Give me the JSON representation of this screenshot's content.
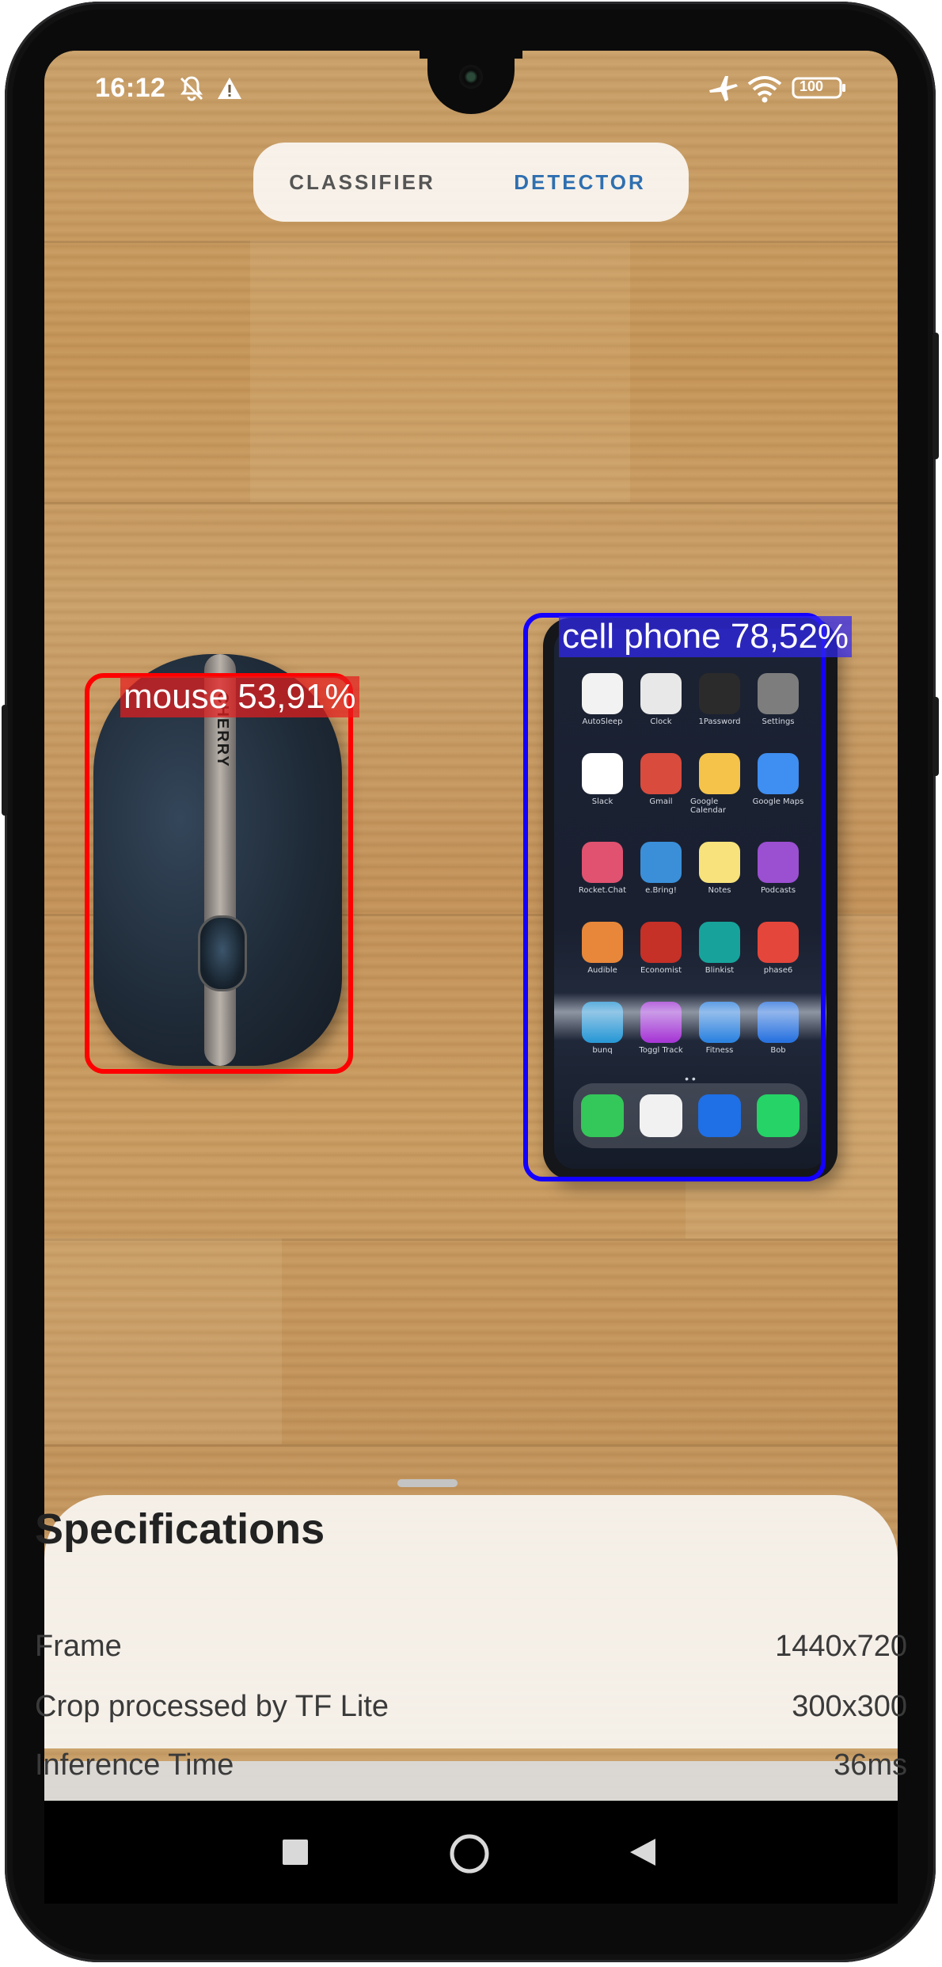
{
  "status_bar": {
    "time": "16:12",
    "battery": "100",
    "left_icons": [
      "notifications-off-icon",
      "warning-icon"
    ],
    "right_icons": [
      "airplane-mode-icon",
      "wifi-icon",
      "battery-icon"
    ]
  },
  "mode_toggle": {
    "tabs": [
      {
        "label": "CLASSIFIER",
        "active": false
      },
      {
        "label": "DETECTOR",
        "active": true
      }
    ],
    "active_color": "#2f6fb0"
  },
  "detections": [
    {
      "label": "mouse 53,91%",
      "color": "#ff0000"
    },
    {
      "label": "cell phone 78,52%",
      "color": "#1400ff"
    }
  ],
  "mouse_object": {
    "brand": "CHERRY"
  },
  "phone_object": {
    "apps": [
      "AutoSleep",
      "Clock",
      "1Password",
      "Settings",
      "Slack",
      "Gmail",
      "Google Calendar",
      "Google Maps",
      "Rocket.Chat",
      "e.Bring!",
      "Notes",
      "Podcasts",
      "Audible",
      "Economist",
      "Blinkist",
      "phase6",
      "bunq",
      "Toggl Track",
      "Fitness",
      "Bob"
    ],
    "dock_icons": [
      "phone-icon",
      "chrome-icon",
      "trello-icon",
      "whatsapp-icon"
    ]
  },
  "specifications": {
    "title": "Specifications",
    "rows": [
      {
        "label": "Frame",
        "value": "1440x720"
      },
      {
        "label": "Crop processed by TF Lite",
        "value": "300x300"
      },
      {
        "label": "Inference Time",
        "value": "36ms"
      }
    ]
  },
  "nav_bar": {
    "buttons": [
      "recents-square-icon",
      "home-circle-icon",
      "back-triangle-icon"
    ]
  }
}
